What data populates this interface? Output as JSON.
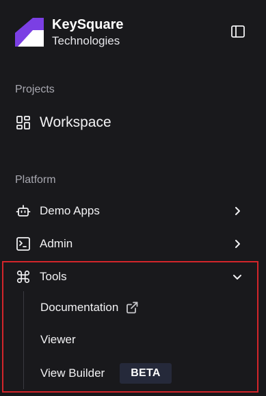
{
  "header": {
    "title": "KeySquare",
    "subtitle": "Technologies",
    "logo_icon": "keysquare-logo",
    "toggle_icon": "sidebar-toggle-icon"
  },
  "sections": {
    "projects": "Projects",
    "platform": "Platform"
  },
  "nav": {
    "workspace": {
      "label": "Workspace",
      "icon": "grid-icon"
    },
    "demo_apps": {
      "label": "Demo Apps",
      "icon": "bot-icon",
      "chevron": "chevron-right"
    },
    "admin": {
      "label": "Admin",
      "icon": "terminal-icon",
      "chevron": "chevron-right"
    },
    "tools": {
      "label": "Tools",
      "icon": "command-icon",
      "chevron": "chevron-down",
      "items": [
        {
          "label": "Documentation",
          "icon": "external-link-icon"
        },
        {
          "label": "Viewer"
        },
        {
          "label": "View Builder",
          "badge": "BETA"
        }
      ]
    }
  },
  "colors": {
    "background": "#19191c",
    "highlight_border": "#d4252a",
    "badge_bg": "#25293a",
    "logo_purple": "#7b3fe4"
  }
}
